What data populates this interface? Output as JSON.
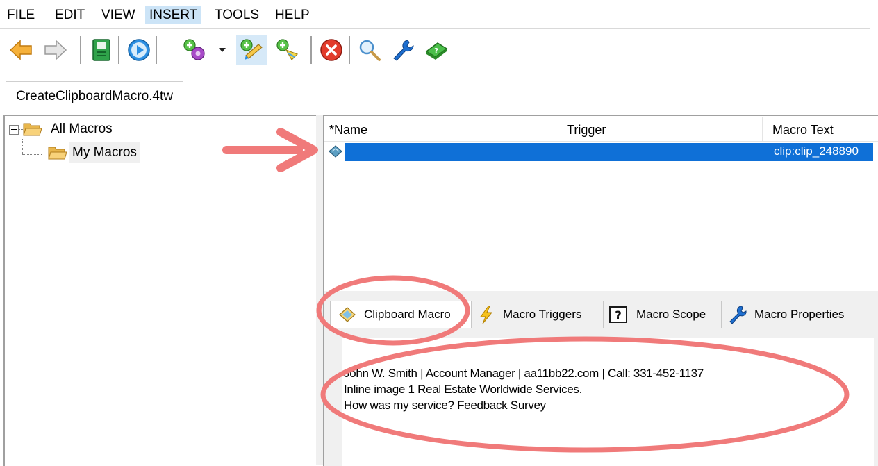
{
  "menu": {
    "items": [
      "FILE",
      "EDIT",
      "VIEW",
      "INSERT",
      "TOOLS",
      "HELP"
    ],
    "active": "INSERT"
  },
  "toolbar": {
    "icons": [
      "back-arrow-icon",
      "forward-arrow-icon",
      "save-icon",
      "play-icon",
      "add-gear-icon",
      "dropdown-arrow-icon",
      "new-clipboard-macro-icon",
      "new-macro-icon",
      "delete-icon",
      "search-icon",
      "wrench-icon",
      "help-book-icon"
    ]
  },
  "document_tab": {
    "label": "CreateClipboardMacro.4tw"
  },
  "tree": {
    "root_label": "All Macros",
    "child_label": "My Macros"
  },
  "list": {
    "columns": [
      "*Name",
      "Trigger",
      "Macro Text"
    ],
    "rows": [
      {
        "name": "",
        "trigger": "",
        "macro_text": "clip:clip_248890"
      }
    ],
    "selected_color": "#0f70d7"
  },
  "bottom_tabs": [
    {
      "label": "Clipboard Macro",
      "icon": "clipboard-macro-icon",
      "active": true
    },
    {
      "label": "Macro Triggers",
      "icon": "lightning-icon",
      "active": false
    },
    {
      "label": "Macro Scope",
      "icon": "question-icon",
      "active": false
    },
    {
      "label": "Macro Properties",
      "icon": "wrench-icon",
      "active": false
    }
  ],
  "clipboard_content": {
    "lines": [
      "John W. Smith  |  Account Manager  |  aa11bb22.com |  Call: 331-452-1137",
      "Inline image 1 Real Estate Worldwide Services.",
      "How was my service?  Feedback Survey"
    ]
  },
  "annotation_color": "#f07a7a"
}
